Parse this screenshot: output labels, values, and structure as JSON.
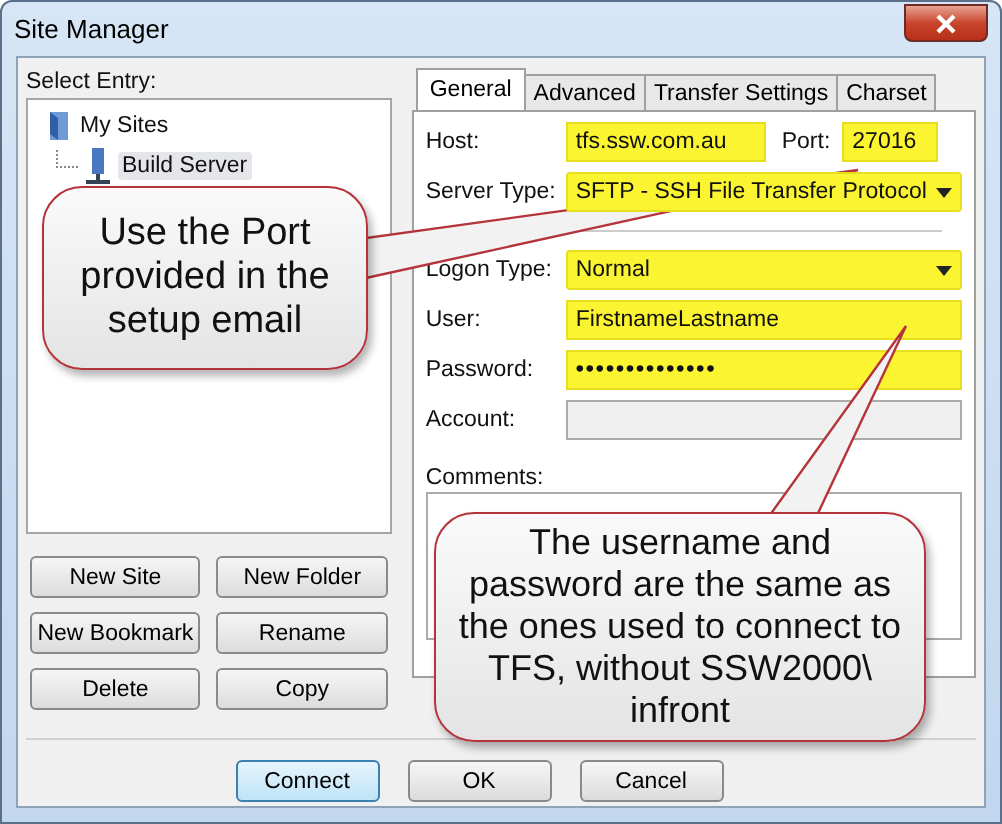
{
  "window": {
    "title": "Site Manager"
  },
  "select_entry_label": "Select Entry:",
  "tree": [
    {
      "label": "My Sites",
      "kind": "folder",
      "selected": false,
      "children": [
        {
          "label": "Build Server",
          "kind": "server",
          "selected": true
        }
      ]
    }
  ],
  "site_buttons": [
    "New Site",
    "New Folder",
    "New Bookmark",
    "Rename",
    "Delete",
    "Copy"
  ],
  "tabs": [
    {
      "label": "General",
      "selected": true
    },
    {
      "label": "Advanced",
      "selected": false
    },
    {
      "label": "Transfer Settings",
      "selected": false
    },
    {
      "label": "Charset",
      "selected": false
    }
  ],
  "host": {
    "label": "Host:",
    "value": "tfs.ssw.com.au",
    "highlighted": true
  },
  "port": {
    "label": "Port:",
    "value": "27016",
    "highlighted": true
  },
  "fields": [
    {
      "kind": "select",
      "label": "Server Type:",
      "value": "SFTP - SSH File Transfer Protocol",
      "highlighted": true
    },
    {
      "kind": "separator"
    },
    {
      "kind": "select",
      "label": "Logon Type:",
      "value": "Normal",
      "highlighted": true
    },
    {
      "kind": "text",
      "label": "User:",
      "value": "FirstnameLastname",
      "highlighted": true
    },
    {
      "kind": "password",
      "label": "Password:",
      "value": "••••••••••••••",
      "highlighted": true
    },
    {
      "kind": "text",
      "label": "Account:",
      "disabled": true,
      "highlighted": false
    }
  ],
  "comments_label": "Comments:",
  "dialog_buttons": [
    {
      "label": "Connect",
      "default": true
    },
    {
      "label": "OK",
      "default": false
    },
    {
      "label": "Cancel",
      "default": false
    }
  ],
  "callouts": [
    {
      "text": "Use the Port provided in the setup email"
    },
    {
      "text": "The username and password are the same as the ones used to connect to TFS, without SSW2000\\ infront"
    }
  ]
}
